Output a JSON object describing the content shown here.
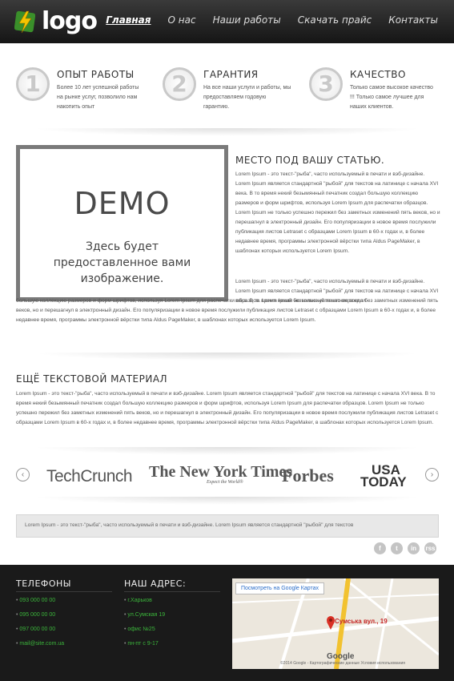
{
  "header": {
    "logo_text": "logo",
    "nav": [
      "Главная",
      "О нас",
      "Наши работы",
      "Скачать прайс",
      "Контакты"
    ]
  },
  "features": [
    {
      "number": "1",
      "title": "ОПЫТ РАБОТЫ",
      "text": "Более 10 лет успешной работы на рынке услуг, позволило нам накопить опыт"
    },
    {
      "number": "2",
      "title": "ГАРАНТИЯ",
      "text": "На все наши услуги и работы, мы предоставляем годовую гарантию."
    },
    {
      "number": "3",
      "title": "КАЧЕСТВО",
      "text": "Только самое высокое качество !!! Только самое лучшее для наших клиентов."
    }
  ],
  "article": {
    "demo_logo": "DEMO",
    "demo_caption": "Здесь будет предоставленное вами изображение.",
    "title": "МЕСТО ПОД ВАШУ СТАТЬЮ.",
    "p1": "Lorem Ipsum - это текст-\"рыба\", часто используемый в печати и вэб-дизайне. Lorem Ipsum является стандартной \"рыбой\" для текстов на латинице с начала XVI века. В то время некий безымянный печатник создал большую коллекцию размеров и форм шрифтов, используя Lorem Ipsum для распечатки образцов. Lorem Ipsum не только успешно пережил без заметных изменений пять веков, но и перешагнул в электронный дизайн. Его популяризации в новое время послужили публикация листов Letraset с образцами Lorem Ipsum в 60-х годах и, в более недавнее время, программы электронной вёрстки типа Aldus PageMaker, в шаблонах которых используется Lorem Ipsum.",
    "p2": "Lorem Ipsum - это текст-\"рыба\", часто используемый в печати и вэб-дизайне. Lorem Ipsum является стандартной \"рыбой\" для текстов на латинице с начала XVI века. В то время некий безымянный печатник создал",
    "p3": "большую коллекцию размеров и форм шрифтов, используя Lorem Ipsum для распечатки образцов. Lorem Ipsum не только успешно пережил без заметных изменений пять веков, но и перешагнул в электронный дизайн. Его популяризации в новое время послужили публикация листов Letraset с образцами Lorem Ipsum в 60-х годах и, в более недавнее время, программы электронной вёрстки типа Aldus PageMaker, в шаблонах которых используется Lorem Ipsum."
  },
  "more": {
    "title": "ЕЩЁ ТЕКСТОВОЙ МАТЕРИАЛ",
    "text": "Lorem Ipsum - это текст-\"рыба\", часто используемый в печати и вэб-дизайне. Lorem Ipsum является стандартной \"рыбой\" для текстов на латинице с начала XVI века. В то время некий безымянный печатник создал большую коллекцию размеров и форм шрифтов, используя Lorem Ipsum для распечатки образцов. Lorem Ipsum не только успешно пережил без заметных изменений пять веков, но и перешагнул в электронный дизайн. Его популяризации в новое время послужили публикация листов Letraset с образцами Lorem Ipsum в 60-х годах и, в более недавнее время, программы электронной вёрстки типа Aldus PageMaker, в шаблонах которых используется Lorem Ipsum."
  },
  "brands": {
    "prev_icon": "‹",
    "next_icon": "›",
    "techcrunch": "TechCrunch",
    "nyt": "The New York Times",
    "nyt_sub": "Expect the World®",
    "forbes": "Forbes",
    "usa1": "USA",
    "usa2": "TODAY"
  },
  "quote": {
    "text": "Lorem Ipsum - это текст-\"рыба\", часто используемый в печати и вэб-дизайне. Lorem Ipsum является стандартной \"рыбой\" для текстов"
  },
  "socials": [
    "f",
    "t",
    "in",
    "rss"
  ],
  "footer": {
    "phones_title": "ТЕЛЕФОНЫ",
    "phones": [
      "093 000 00 00",
      "095 000 00 00",
      "097 000 00 00",
      "mail@site.com.ua"
    ],
    "address_title": "НАШ АДРЕС:",
    "address": [
      "г.Харьков",
      "ул.Сумская 19",
      "офис №25",
      "пн-пт с 9-17"
    ]
  },
  "map": {
    "button": "Посмотреть на Google Картах",
    "label": "Сумська вул., 19",
    "google": "Google",
    "copyright": "©2014 Google - Картографические данные    Условия использования"
  },
  "colors": {
    "header_bg": "#1e1e1e",
    "footer_bg": "#1a1a1a",
    "footer_link": "#3bb43b",
    "logo_bolt": "#f5c400"
  }
}
